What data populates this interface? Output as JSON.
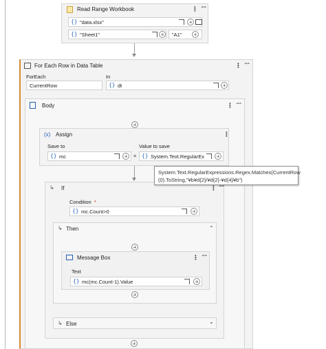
{
  "read_range": {
    "title": "Read Range Workbook",
    "workbook_path": "\"data.xlsx\"",
    "sheet_name": "\"Sheet1\"",
    "range": "\"A1\""
  },
  "for_each_row": {
    "title": "For Each Row in Data Table",
    "foreach_label": "ForEach",
    "foreach_value": "CurrentRow",
    "in_label": "In",
    "in_value": "dt"
  },
  "body": {
    "title": "Body"
  },
  "assign": {
    "title": "Assign",
    "icon_text": "(x)",
    "save_to_label": "Save to",
    "save_to_value": "mc",
    "equals": "=",
    "value_label": "Value to save",
    "value_value": "System.Text.RegularEx"
  },
  "tooltip": {
    "line1": "System.Text.RegularExpressions.Regex.Matches(CurrentRow",
    "line2": "(0).ToString,\"¥b¥d{2}/¥d{2}-¥d{4}¥b\")"
  },
  "if_block": {
    "title": "If",
    "condition_label": "Condition",
    "required_mark": "*",
    "condition_value": "mc.Count>0"
  },
  "then_block": {
    "title": "Then"
  },
  "message_box": {
    "title": "Message Box",
    "text_label": "Text",
    "text_value": "mc(mc.Count-1).Value"
  },
  "else_block": {
    "title": "Else"
  },
  "glyphs": {
    "brace": "{}",
    "kebab": "⋮",
    "collapse": "⌃⌃",
    "chevron_up": "⌃",
    "chevron_down": "⌄",
    "branch": "↳"
  },
  "colors": {
    "accent_blue": "#1f5fb4",
    "card_bg": "#f3f3f3",
    "border": "#d4d4d4"
  }
}
